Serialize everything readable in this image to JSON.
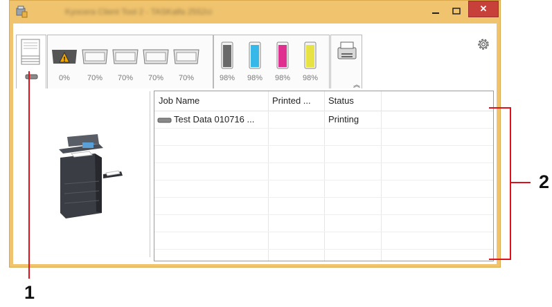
{
  "window": {
    "title": "Kyocera Client Tool 2 - TASKalfa 2552ci"
  },
  "toolbar": {
    "tabs": [
      {
        "name": "jobs",
        "active": true
      },
      {
        "name": "paper-trays"
      },
      {
        "name": "toner"
      },
      {
        "name": "device"
      }
    ],
    "paper_levels": [
      "0%",
      "70%",
      "70%",
      "70%",
      "70%"
    ],
    "toner_levels": [
      "98%",
      "98%",
      "98%",
      "98%"
    ],
    "toner_colors": [
      "#6a6a6a",
      "#36b9e8",
      "#e0308f",
      "#e8e345"
    ],
    "paper_warning_color": "#f2a600"
  },
  "jobs_table": {
    "columns": [
      "Job Name",
      "Printed ...",
      "Status",
      ""
    ],
    "rows": [
      {
        "job_name": "Test Data 010716 ...",
        "printed": "",
        "status": "Printing"
      }
    ]
  },
  "callouts": {
    "left": "1",
    "right": "2"
  }
}
